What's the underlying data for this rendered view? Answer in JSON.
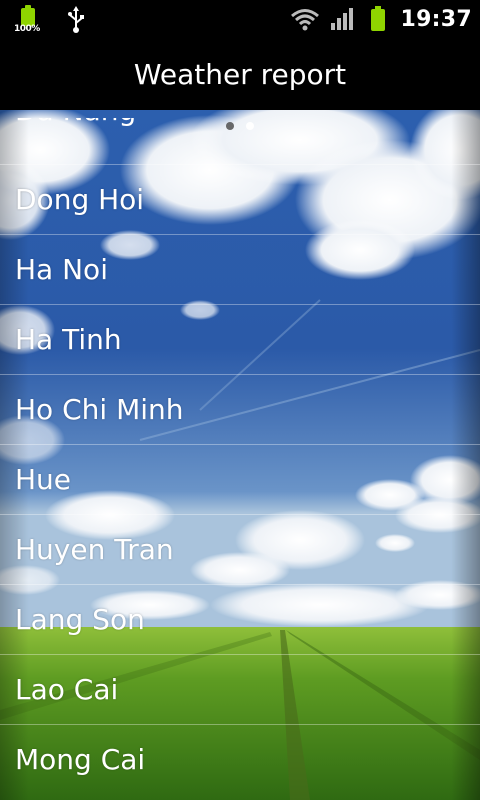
{
  "status_bar": {
    "battery_small_label": "100%",
    "time": "19:37",
    "icons": [
      "battery-charging-icon",
      "usb-icon",
      "wifi-icon",
      "signal-icon",
      "battery-icon"
    ],
    "accent_color": "#8fd400"
  },
  "header": {
    "title": "Weather report"
  },
  "pager": {
    "page_count": 2,
    "active_index": 1
  },
  "cities": {
    "partial_top": "Da Nang",
    "items": [
      "Dong Hoi",
      "Ha Noi",
      "Ha Tinh",
      "Ho Chi Minh",
      "Hue",
      "Huyen Tran",
      "Lang Son",
      "Lao Cai",
      "Mong Cai"
    ]
  }
}
